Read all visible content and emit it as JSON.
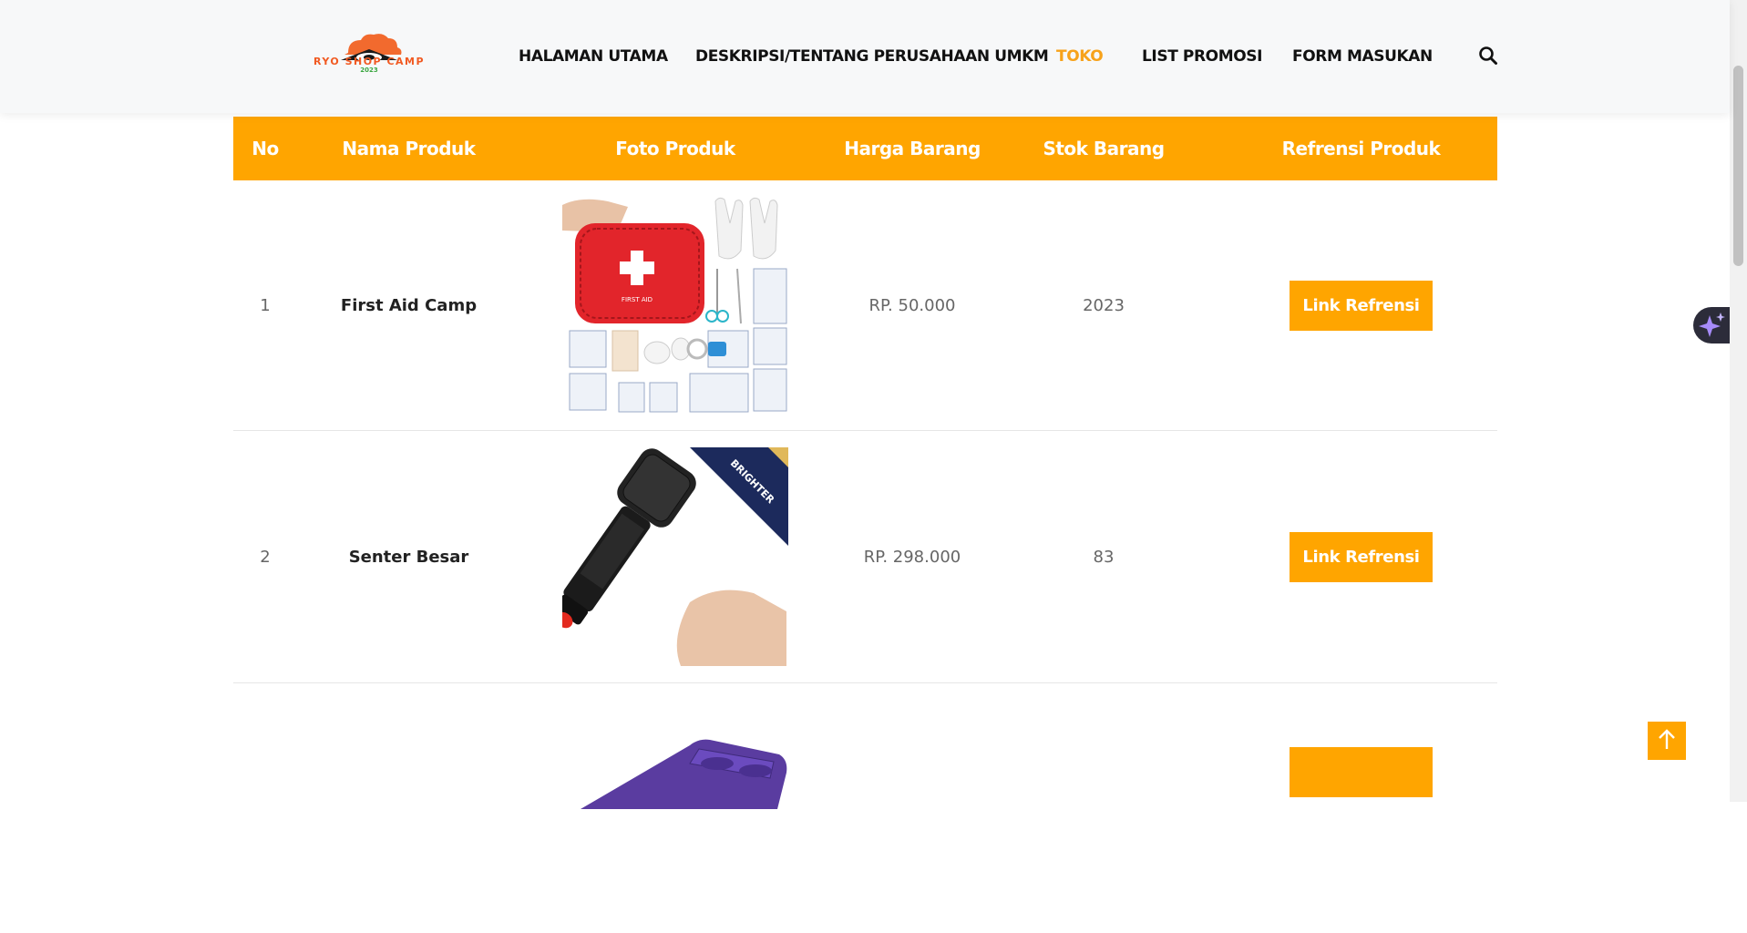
{
  "header": {
    "logo": {
      "text": "RYO SHOP CAMP",
      "year": "2023"
    },
    "nav": [
      {
        "label": "HALAMAN UTAMA",
        "active": false
      },
      {
        "label": "DESKRIPSI/TENTANG PERUSAHAAN UMKM",
        "active": false
      },
      {
        "label": "TOKO",
        "active": true
      },
      {
        "label": "LIST PROMOSI",
        "active": false
      },
      {
        "label": "FORM MASUKAN",
        "active": false
      }
    ],
    "search_icon": "search-icon"
  },
  "table": {
    "columns": [
      "No",
      "Nama Produk",
      "Foto Produk",
      "Harga Barang",
      "Stok Barang",
      "Refrensi Produk"
    ],
    "rows": [
      {
        "no": "1",
        "name": "First Aid Camp",
        "photo": "first-aid-kit-photo",
        "price": "RP. 50.000",
        "stock": "2023",
        "link": "Link Refrensi"
      },
      {
        "no": "2",
        "name": "Senter Besar",
        "photo": "flashlight-photo",
        "price": "RP. 298.000",
        "stock": "83",
        "link": "Link Refrensi"
      },
      {
        "no": "",
        "name": "",
        "photo": "sleeping-pad-photo",
        "price": "",
        "stock": "",
        "link": ""
      }
    ]
  },
  "colors": {
    "accent": "#ffa500",
    "nav_active": "#f7a21b"
  },
  "icons": {
    "float": "sparkle-icon",
    "back_to_top": "arrow-up-icon"
  }
}
